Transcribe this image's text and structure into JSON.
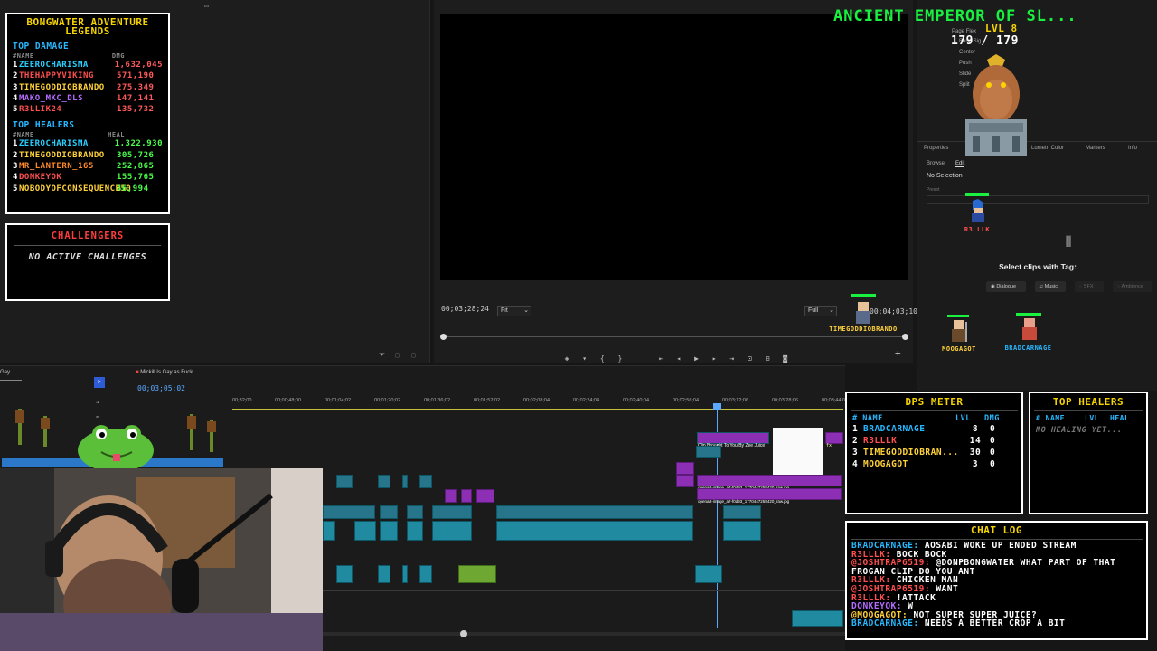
{
  "leaderboard": {
    "title_line1": "BONGWATER ADVENTURE",
    "title_line2": "LEGENDS",
    "damage": {
      "heading": "TOP DAMAGE",
      "col_name": "#NAME",
      "col_value": "DMG",
      "rows": [
        {
          "rank": "1",
          "name": "ZEEROCHARISMA",
          "value": "1,632,045",
          "color": "#2ad0ff"
        },
        {
          "rank": "2",
          "name": "THEHAPPYVIKING",
          "value": "571,190",
          "color": "#ff4f4f"
        },
        {
          "rank": "3",
          "name": "TIMEGODDIOBRANDO",
          "value": "275,349",
          "color": "#ffd23a"
        },
        {
          "rank": "4",
          "name": "MAKO_MKC_DLS",
          "value": "147,141",
          "color": "#b56cff"
        },
        {
          "rank": "5",
          "name": "R3LLIK24",
          "value": "135,732",
          "color": "#ff4f4f"
        }
      ]
    },
    "healers": {
      "heading": "TOP HEALERS",
      "col_name": "#NAME",
      "col_value": "HEAL",
      "rows": [
        {
          "rank": "1",
          "name": "ZEEROCHARISMA",
          "value": "1,322,930",
          "color": "#2ad0ff"
        },
        {
          "rank": "2",
          "name": "TIMEGODDIOBRANDO",
          "value": "305,726",
          "color": "#ffd23a"
        },
        {
          "rank": "3",
          "name": "MR_LANTERN_165",
          "value": "252,865",
          "color": "#ff8a2a"
        },
        {
          "rank": "4",
          "name": "DONKEYOK",
          "value": "155,765",
          "color": "#ff4f4f"
        },
        {
          "rank": "5",
          "name": "NOBODYOFCONSEQUENCE50",
          "value": "46,994",
          "color": "#ffd23a"
        }
      ]
    }
  },
  "challengers": {
    "title": "CHALLENGERS",
    "message": "NO ACTIVE CHALLENGES"
  },
  "program": {
    "left_timecode": "00;03;28;24",
    "fit_label": "Fit",
    "quality_label": "Full",
    "right_timecode": "00;04;03;10"
  },
  "boss": {
    "name": "ANCIENT EMPEROR OF SL...",
    "level": "LVL 8",
    "hp_current": "179",
    "hp_sep": "/",
    "hp_max": "179"
  },
  "right_panel": {
    "tabs": [
      "Properties",
      "Lumetri Color",
      "Markers",
      "Info"
    ],
    "subtabs": [
      "Browse",
      "Edit"
    ],
    "no_selection": "No Selection",
    "preset_label": "Preset",
    "select_clips": "Select clips with Tag:",
    "tags": [
      "Dialogue",
      "Music",
      "SFX",
      "Ambience"
    ],
    "layers": [
      "Page Flex",
      "Band Sig",
      "Center",
      "Push",
      "Slide",
      "Split"
    ]
  },
  "characters": {
    "player_top": "R3LLLK",
    "player_video": "TIMEGODDIOBRANDO",
    "player_left": "MOOGAGOT",
    "player_right": "BRADCARNAGE"
  },
  "timeline": {
    "sequence_tab": "Gay",
    "sequence_name": "Mickill Is Gay as Fuck",
    "playhead_time": "00;03;05;02",
    "ruler": [
      "00;32;00",
      "00;00;48;00",
      "00;01;04;02",
      "00;01;20;02",
      "00;01;36;02",
      "00;01;52;02",
      "00;02;08;04",
      "00;02;24;04",
      "00;02;40;04",
      "00;02;56;04",
      "00;03;12;06",
      "00;03;28;06",
      "00;03;44;06"
    ],
    "clip_title": "Clip Brought To You By Zee Juice",
    "clip_image1": "openart-image_a7-f0d93_1770447259420_raw.jpg",
    "clip_image2": "openart-image_a7-f0d93_1770447259420_raw.jpg",
    "fx": "fx"
  },
  "dps_meter": {
    "title": "DPS METER",
    "col_name": "# NAME",
    "col_lvl": "LVL",
    "col_dmg": "DMG",
    "rows": [
      {
        "rank": "1",
        "name": "BRADCARNAGE",
        "lvl": "8",
        "dmg": "0",
        "color": "#27b8ff"
      },
      {
        "rank": "2",
        "name": "R3LLLK",
        "lvl": "14",
        "dmg": "0",
        "color": "#ff4f4f"
      },
      {
        "rank": "3",
        "name": "TIMEGODDIOBRAN...",
        "lvl": "30",
        "dmg": "0",
        "color": "#ffd23a"
      },
      {
        "rank": "4",
        "name": "MOOGAGOT",
        "lvl": "3",
        "dmg": "0",
        "color": "#ffd23a"
      }
    ]
  },
  "top_healers_panel": {
    "title": "TOP HEALERS",
    "col_name": "# NAME",
    "col_lvl": "LVL",
    "col_heal": "HEAL",
    "empty": "NO HEALING YET..."
  },
  "chat": {
    "title": "CHAT LOG",
    "lines": [
      {
        "user": "BRADCARNAGE:",
        "msg": "AOSABI WOKE UP ENDED STREAM",
        "color": "#27b8ff"
      },
      {
        "user": "R3LLLK:",
        "msg": "BOCK BOCK",
        "color": "#ff4f4f"
      },
      {
        "user": "@JOSHTRAP6519:",
        "msg": "@DONPBONGWATER WHAT PART OF THAT",
        "color": "#ff4f4f"
      },
      {
        "user": "",
        "msg": "FROGAN CLIP DO YOU ANT",
        "color": "#ffffff"
      },
      {
        "user": "R3LLLK:",
        "msg": "CHICKEN MAN",
        "color": "#ff4f4f"
      },
      {
        "user": "@JOSHTRAP6519:",
        "msg": "WANT",
        "color": "#ff4f4f"
      },
      {
        "user": "R3LLLK:",
        "msg": "!ATTACK",
        "color": "#ff4f4f"
      },
      {
        "user": "DONKEYOK:",
        "msg": "W",
        "color": "#b56cff"
      },
      {
        "user": "@MOOGAGOT:",
        "msg": "NOT SUPER SUPER JUICE?",
        "color": "#ffd23a"
      },
      {
        "user": "BRADCARNAGE:",
        "msg": "NEEDS A BETTER CROP A BIT",
        "color": "#27b8ff"
      }
    ]
  },
  "colors": {
    "boss_green": "#19f03f",
    "gold": "#f5d400",
    "blue": "#27b8ff",
    "red": "#ff3c3c",
    "heal_green": "#4cff4c"
  }
}
